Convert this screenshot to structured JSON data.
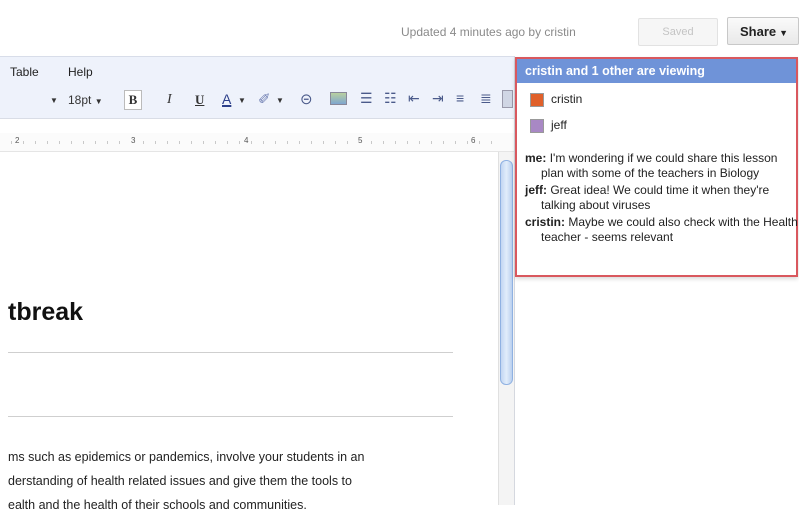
{
  "header": {
    "updated_text": "Updated 4 minutes ago by cristin",
    "saved_label": "Saved",
    "share_label": "Share"
  },
  "menu": {
    "items": [
      "Table",
      "Help"
    ]
  },
  "toolbar": {
    "font_size": "18pt",
    "bold": "B",
    "italic": "I",
    "underline": "U",
    "text_color": "A",
    "icons": [
      "link-icon",
      "image-icon",
      "numbered-list-icon",
      "bulleted-list-icon",
      "decrease-indent-icon",
      "increase-indent-icon"
    ]
  },
  "ruler": {
    "labels": [
      "2",
      "3",
      "4",
      "5",
      "6"
    ]
  },
  "document": {
    "heading": "tbreak",
    "paragraph_lines": [
      "ms such as epidemics or pandemics, involve your students in an",
      "derstanding of health related issues and give them the tools to",
      "ealth and the health of their schools and communities."
    ]
  },
  "viewers_panel": {
    "title": "cristin and 1 other are viewing",
    "viewers": [
      {
        "name": "cristin",
        "color": "#e0602a"
      },
      {
        "name": "jeff",
        "color": "#a888c4"
      }
    ],
    "chat": [
      {
        "author": "me:",
        "text": "I'm wondering if we could share this lesson plan with some of the teachers in Biology"
      },
      {
        "author": "jeff:",
        "text": "Great idea! We could time it when they're talking about viruses"
      },
      {
        "author": "cristin:",
        "text": "Maybe we could also check with the Health teacher - seems relevant"
      }
    ]
  }
}
